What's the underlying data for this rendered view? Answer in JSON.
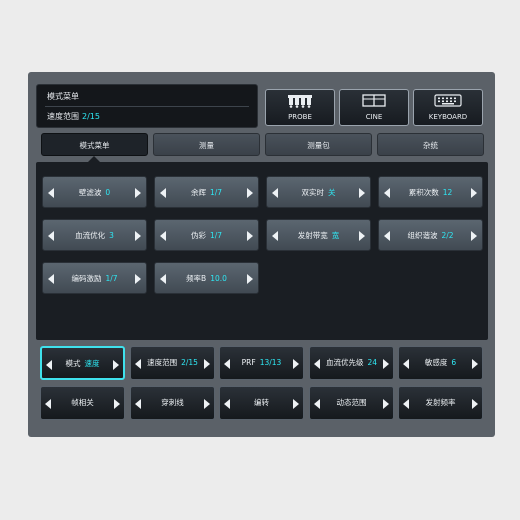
{
  "breadcrumb": {
    "title": "模式菜单",
    "sub_label": "速度范围",
    "sub_value": "2/15"
  },
  "top_buttons": [
    {
      "label": "PROBE",
      "icon": "probe-icon"
    },
    {
      "label": "CINE",
      "icon": "cine-icon"
    },
    {
      "label": "KEYBOARD",
      "icon": "keyboard-icon"
    }
  ],
  "tabs": [
    {
      "label": "模式菜单",
      "active": true
    },
    {
      "label": "测量",
      "active": false
    },
    {
      "label": "测量包",
      "active": false
    },
    {
      "label": "杂统",
      "active": false
    }
  ],
  "params": [
    {
      "label": "壁滤波",
      "value": "0"
    },
    {
      "label": "余辉",
      "value": "1/7"
    },
    {
      "label": "双实时",
      "value": "关"
    },
    {
      "label": "累积次数",
      "value": "12"
    },
    {
      "label": "血流优化",
      "value": "3"
    },
    {
      "label": "伪彩",
      "value": "1/7"
    },
    {
      "label": "发射带宽",
      "value": "宽"
    },
    {
      "label": "组织谐波",
      "value": "2/2"
    },
    {
      "label": "编码激励",
      "value": "1/7"
    },
    {
      "label": "频率B",
      "value": "10.0"
    }
  ],
  "bottom_row1": [
    {
      "label": "模式",
      "value": "速度",
      "selected": true
    },
    {
      "label": "速度范围",
      "value": "2/15"
    },
    {
      "label": "PRF",
      "value": "13/13"
    },
    {
      "label": "血流优先级",
      "value": "24"
    },
    {
      "label": "敏感度",
      "value": "6"
    }
  ],
  "bottom_row2": [
    {
      "label": "帧相关",
      "value": ""
    },
    {
      "label": "穿刺线",
      "value": ""
    },
    {
      "label": "编转",
      "value": ""
    },
    {
      "label": "动态范围",
      "value": ""
    },
    {
      "label": "发射频率",
      "value": ""
    }
  ],
  "colors": {
    "accent": "#2ee8f4",
    "panel": "#5b6168",
    "dark": "#1a1e23"
  }
}
